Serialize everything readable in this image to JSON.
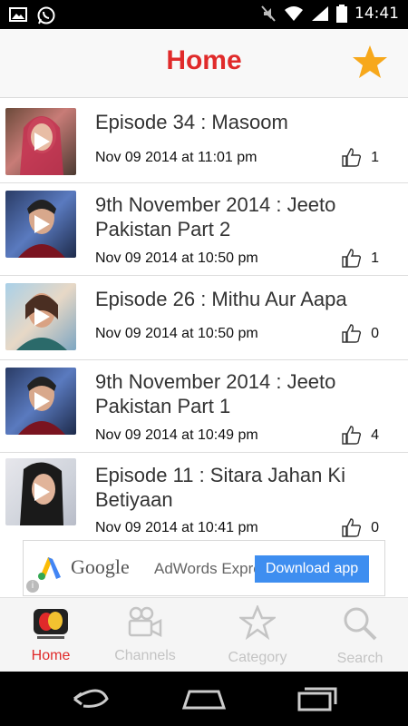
{
  "status": {
    "time": "14:41",
    "left_icons": [
      "gallery-icon",
      "whatsapp-icon"
    ],
    "right_icons": [
      "mute-icon",
      "wifi-icon",
      "signal-icon",
      "battery-icon"
    ]
  },
  "header": {
    "title": "Home",
    "favorite_icon": "star-icon",
    "accent": "#e02a2a",
    "star_color": "#f7a81b"
  },
  "episodes": [
    {
      "title": "Episode 34 : Masoom",
      "date": "Nov 09 2014 at 11:01 pm",
      "likes": "1"
    },
    {
      "title": "9th November 2014 : Jeeto Pakistan Part 2",
      "date": "Nov 09 2014 at 10:50 pm",
      "likes": "1"
    },
    {
      "title": "Episode 26 : Mithu Aur Aapa",
      "date": "Nov 09 2014 at 10:50 pm",
      "likes": "0"
    },
    {
      "title": "9th November 2014 : Jeeto Pakistan Part 1",
      "date": "Nov 09 2014 at 10:49 pm",
      "likes": "4"
    },
    {
      "title": "Episode 11 : Sitara Jahan Ki Betiyaan",
      "date": "Nov 09 2014 at 10:41 pm",
      "likes": "0"
    }
  ],
  "ad": {
    "brand": "Google",
    "product": "AdWords Express",
    "cta": "Download app",
    "cta_color": "#3e8ef0"
  },
  "tabs": [
    {
      "label": "Home",
      "icon": "dramas-online-logo-icon",
      "active": true
    },
    {
      "label": "Channels",
      "icon": "video-camera-icon",
      "active": false
    },
    {
      "label": "Category",
      "icon": "star-outline-icon",
      "active": false
    },
    {
      "label": "Search",
      "icon": "search-icon",
      "active": false
    }
  ],
  "nav": {
    "icons": [
      "back-icon",
      "home-icon",
      "recent-apps-icon"
    ]
  }
}
